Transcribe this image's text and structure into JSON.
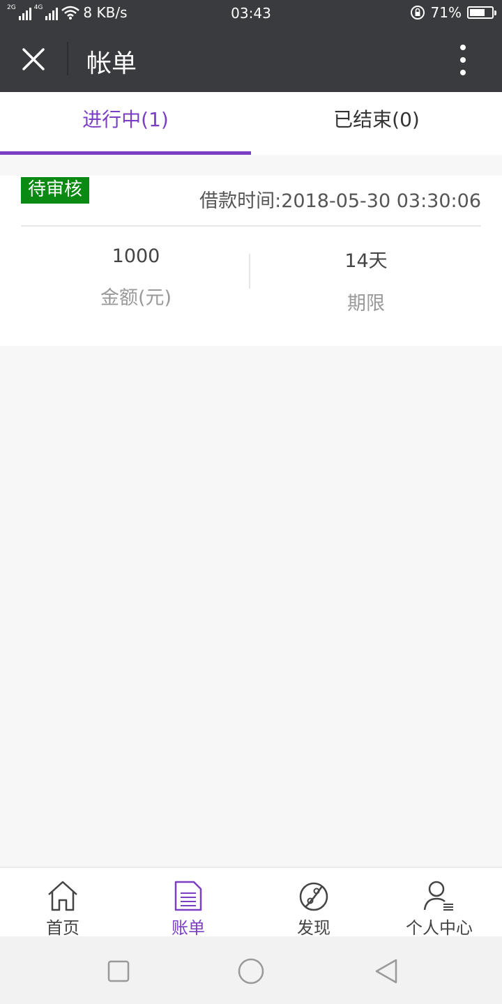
{
  "status_bar": {
    "net1": "2G",
    "net2": "4G",
    "speed": "8 KB/s",
    "time": "03:43",
    "battery": "71%",
    "battery_level": 0.71
  },
  "header": {
    "title": "帐单"
  },
  "tabs": [
    {
      "label": "进行中(1)",
      "active": true
    },
    {
      "label": "已结束(0)",
      "active": false
    }
  ],
  "loan": {
    "status": "待审核",
    "time": "借款时间:2018-05-30 03:30:06",
    "amount": "1000",
    "amount_label": "金额(元)",
    "term": "14天",
    "term_label": "期限"
  },
  "bottom_nav": [
    {
      "label": "首页",
      "icon": "home-icon"
    },
    {
      "label": "账单",
      "icon": "bill-icon",
      "active": true
    },
    {
      "label": "发现",
      "icon": "planet-icon"
    },
    {
      "label": "个人中心",
      "icon": "user-icon"
    }
  ],
  "colors": {
    "accent": "#7b3fc4",
    "header_bg": "#3a3b3f",
    "status_badge": "#0a8a12"
  }
}
